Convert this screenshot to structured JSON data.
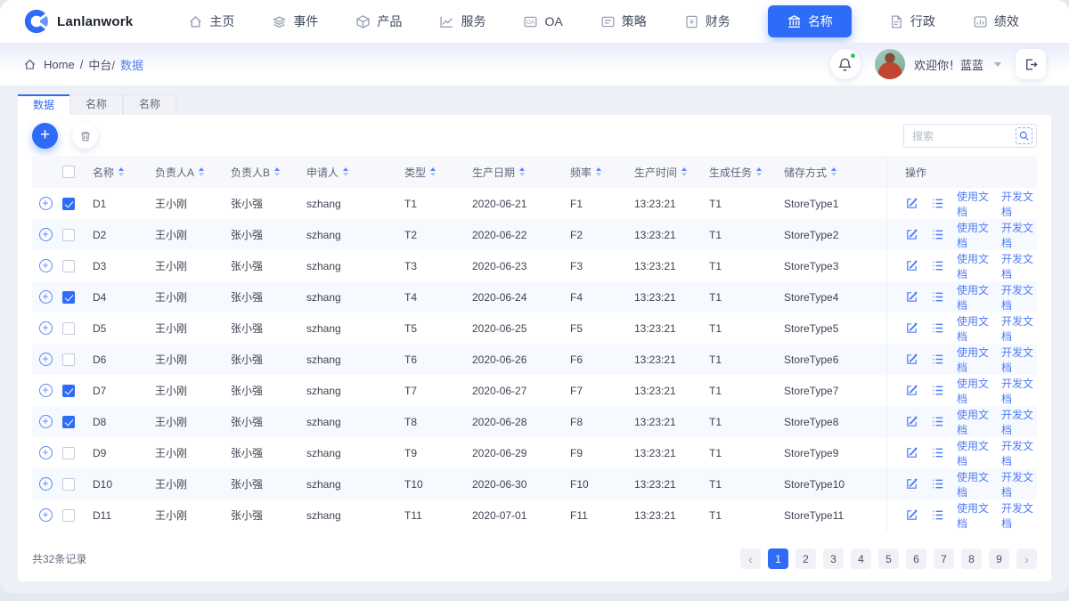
{
  "brand": {
    "name": "Lanlanwork"
  },
  "nav": {
    "items": [
      {
        "label": "主页",
        "icon": "home-icon",
        "active": false
      },
      {
        "label": "事件",
        "icon": "layers-icon",
        "active": false
      },
      {
        "label": "产品",
        "icon": "box-icon",
        "active": false
      },
      {
        "label": "服务",
        "icon": "line-chart-icon",
        "active": false
      },
      {
        "label": "OA",
        "icon": "oa-icon",
        "active": false
      },
      {
        "label": "策略",
        "icon": "card-lines-icon",
        "active": false
      },
      {
        "label": "财务",
        "icon": "yen-icon",
        "active": false
      },
      {
        "label": "名称",
        "icon": "bank-icon",
        "active": true
      },
      {
        "label": "行政",
        "icon": "document-icon",
        "active": false
      },
      {
        "label": "绩效",
        "icon": "gauge-icon",
        "active": false
      }
    ]
  },
  "header": {
    "breadcrumb": {
      "home": "Home",
      "sep1": "/",
      "section": "中台/",
      "current": "数据"
    },
    "welcome": "欢迎你！蓝蓝"
  },
  "tabs": [
    {
      "label": "数据",
      "active": true
    },
    {
      "label": "名称",
      "active": false
    },
    {
      "label": "名称",
      "active": false
    }
  ],
  "toolbar": {
    "search_placeholder": "搜索"
  },
  "table": {
    "columns": [
      "名称",
      "负责人A",
      "负责人B",
      "申请人",
      "类型",
      "生产日期",
      "频率",
      "生产时间",
      "生成任务",
      "储存方式"
    ],
    "actions_column": "操作",
    "action_links": {
      "usage": "使用文档",
      "dev": "开发文档"
    },
    "rows": [
      {
        "name": "D1",
        "owner_a": "王小刚",
        "owner_b": "张小强",
        "applicant": "szhang",
        "type": "T1",
        "date": "2020-06-21",
        "freq": "F1",
        "time": "13:23:21",
        "task": "T1",
        "store": "StoreType1",
        "checked": true
      },
      {
        "name": "D2",
        "owner_a": "王小刚",
        "owner_b": "张小强",
        "applicant": "szhang",
        "type": "T2",
        "date": "2020-06-22",
        "freq": "F2",
        "time": "13:23:21",
        "task": "T1",
        "store": "StoreType2",
        "checked": false
      },
      {
        "name": "D3",
        "owner_a": "王小刚",
        "owner_b": "张小强",
        "applicant": "szhang",
        "type": "T3",
        "date": "2020-06-23",
        "freq": "F3",
        "time": "13:23:21",
        "task": "T1",
        "store": "StoreType3",
        "checked": false
      },
      {
        "name": "D4",
        "owner_a": "王小刚",
        "owner_b": "张小强",
        "applicant": "szhang",
        "type": "T4",
        "date": "2020-06-24",
        "freq": "F4",
        "time": "13:23:21",
        "task": "T1",
        "store": "StoreType4",
        "checked": true
      },
      {
        "name": "D5",
        "owner_a": "王小刚",
        "owner_b": "张小强",
        "applicant": "szhang",
        "type": "T5",
        "date": "2020-06-25",
        "freq": "F5",
        "time": "13:23:21",
        "task": "T1",
        "store": "StoreType5",
        "checked": false
      },
      {
        "name": "D6",
        "owner_a": "王小刚",
        "owner_b": "张小强",
        "applicant": "szhang",
        "type": "T6",
        "date": "2020-06-26",
        "freq": "F6",
        "time": "13:23:21",
        "task": "T1",
        "store": "StoreType6",
        "checked": false
      },
      {
        "name": "D7",
        "owner_a": "王小刚",
        "owner_b": "张小强",
        "applicant": "szhang",
        "type": "T7",
        "date": "2020-06-27",
        "freq": "F7",
        "time": "13:23:21",
        "task": "T1",
        "store": "StoreType7",
        "checked": true
      },
      {
        "name": "D8",
        "owner_a": "王小刚",
        "owner_b": "张小强",
        "applicant": "szhang",
        "type": "T8",
        "date": "2020-06-28",
        "freq": "F8",
        "time": "13:23:21",
        "task": "T1",
        "store": "StoreType8",
        "checked": true
      },
      {
        "name": "D9",
        "owner_a": "王小刚",
        "owner_b": "张小强",
        "applicant": "szhang",
        "type": "T9",
        "date": "2020-06-29",
        "freq": "F9",
        "time": "13:23:21",
        "task": "T1",
        "store": "StoreType9",
        "checked": false
      },
      {
        "name": "D10",
        "owner_a": "王小刚",
        "owner_b": "张小强",
        "applicant": "szhang",
        "type": "T10",
        "date": "2020-06-30",
        "freq": "F10",
        "time": "13:23:21",
        "task": "T1",
        "store": "StoreType10",
        "checked": false
      },
      {
        "name": "D11",
        "owner_a": "王小刚",
        "owner_b": "张小强",
        "applicant": "szhang",
        "type": "T11",
        "date": "2020-07-01",
        "freq": "F11",
        "time": "13:23:21",
        "task": "T1",
        "store": "StoreType11",
        "checked": false
      }
    ]
  },
  "pagination": {
    "total": "共32条记录",
    "prev": "‹",
    "next": "›",
    "pages": [
      "1",
      "2",
      "3",
      "4",
      "5",
      "6",
      "7",
      "8",
      "9"
    ],
    "active": "1"
  },
  "colors": {
    "primary": "#2e6bf6",
    "link": "#4e7cf5",
    "stripe": "#f6f9fd",
    "page_bg": "#eef0f7"
  }
}
